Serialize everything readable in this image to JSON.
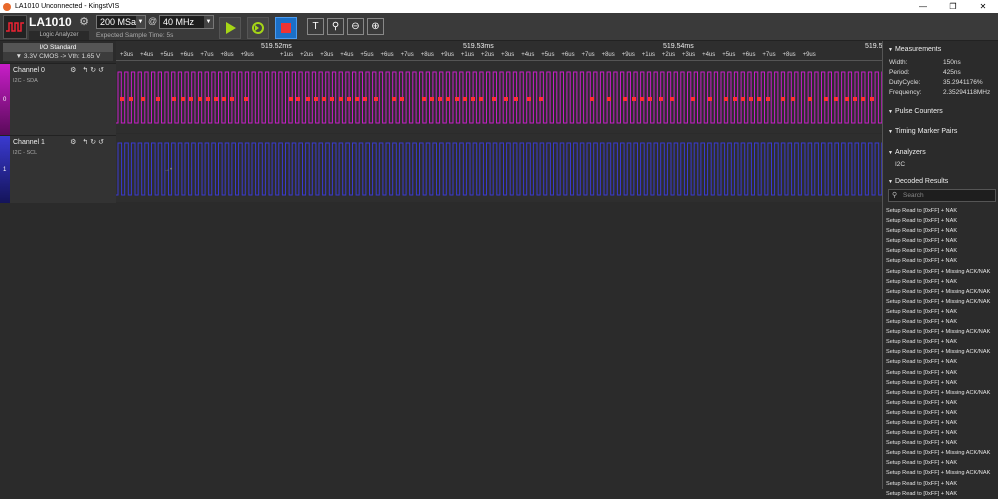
{
  "window": {
    "title": "LA1010 Unconnected - KingstVIS",
    "min": "—",
    "restore": "❐",
    "close": "✕"
  },
  "device": {
    "name": "LA1010",
    "subtitle": "Logic Analyzer"
  },
  "sampling": {
    "rate": "200 MSa",
    "at": "@",
    "frequency": "40 MHz",
    "expected": "Expected Sample Time: 5s"
  },
  "io": {
    "standard": "I/O Standard",
    "level": "▼ 3.3V CMOS  -> Vth: 1.65 V"
  },
  "channels": [
    {
      "name": "Channel 0",
      "sub": "I2C - SDA",
      "num": "0",
      "color": "#c81ec8"
    },
    {
      "name": "Channel 1",
      "sub": "I2C - SCL",
      "num": "1",
      "color": "#3a3ad0"
    }
  ],
  "ruler": {
    "major": [
      "519.52ms",
      "519.53ms",
      "519.54ms",
      "519.5"
    ],
    "ticks": [
      "+3us",
      "+4us",
      "+5us",
      "+6us",
      "+7us",
      "+8us",
      "+9us",
      "+1us",
      "+2us",
      "+3us",
      "+4us",
      "+5us",
      "+6us",
      "+7us",
      "+8us",
      "+9us",
      "+1us",
      "+2us",
      "+3us",
      "+4us",
      "+5us",
      "+6us",
      "+7us",
      "+8us",
      "+9us",
      "+1us",
      "+2us",
      "+3us",
      "+4us",
      "+5us",
      "+6us",
      "+7us",
      "+8us",
      "+9us"
    ]
  },
  "right": {
    "measurements": "Measurements",
    "meas": [
      {
        "label": "Width:",
        "value": "150ns"
      },
      {
        "label": "Period:",
        "value": "425ns"
      },
      {
        "label": "DutyCycle:",
        "value": "35.2941176%"
      },
      {
        "label": "Frequency:",
        "value": "2.35294118MHz"
      }
    ],
    "pulse": "Pulse Counters",
    "timing": "Timing Marker Pairs",
    "analyzers": "Analyzers",
    "analyzer_item": "I2C",
    "decoded": "Decoded Results",
    "search_placeholder": "Search",
    "results": [
      "Setup Read to [0xFF] + NAK",
      "Setup Read to [0xFF] + NAK",
      "Setup Read to [0xFF] + NAK",
      "Setup Read to [0xFF] + NAK",
      "Setup Read to [0xFF] + NAK",
      "Setup Read to [0xFF] + NAK",
      "Setup Read to [0xFF] + Missing ACK/NAK",
      "Setup Read to [0xFF] + NAK",
      "Setup Read to [0xFF] + Missing ACK/NAK",
      "Setup Read to [0xFF] + Missing ACK/NAK",
      "Setup Read to [0xFF] + NAK",
      "Setup Read to [0xFF] + NAK",
      "Setup Read to [0xFF] + Missing ACK/NAK",
      "Setup Read to [0xFF] + NAK",
      "Setup Read to [0xFF] + Missing ACK/NAK",
      "Setup Read to [0xFF] + NAK",
      "Setup Read to [0xFF] + NAK",
      "Setup Read to [0xFF] + NAK",
      "Setup Read to [0xFF] + Missing ACK/NAK",
      "Setup Read to [0xFF] + NAK",
      "Setup Read to [0xFF] + NAK",
      "Setup Read to [0xFF] + NAK",
      "Setup Read to [0xFF] + NAK",
      "Setup Read to [0xFF] + NAK",
      "Setup Read to [0xFF] + Missing ACK/NAK",
      "Setup Read to [0xFF] + NAK",
      "Setup Read to [0xFF] + Missing ACK/NAK",
      "Setup Read to [0xFF] + NAK",
      "Setup Read to [0xFF] + NAK"
    ]
  }
}
